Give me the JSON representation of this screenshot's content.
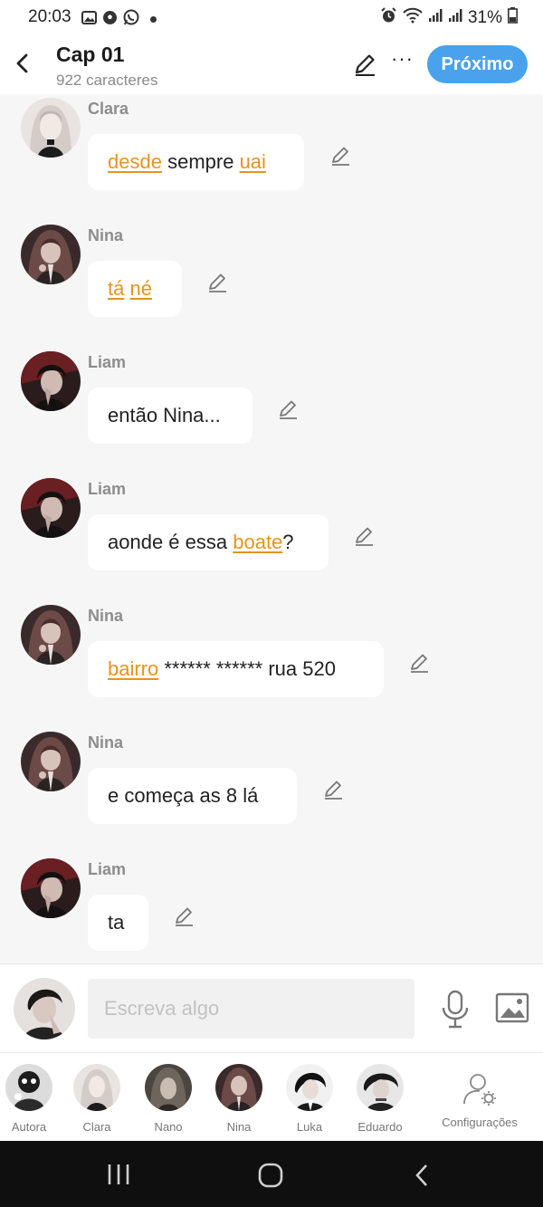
{
  "status_bar": {
    "time": "20:03",
    "battery": "31%",
    "left_icons": [
      "gallery-icon",
      "soccer-icon",
      "whatsapp-icon",
      "dot-icon"
    ],
    "right_icons": [
      "alarm-icon",
      "wifi-icon",
      "signal-icon",
      "signal-icon",
      "battery-icon"
    ]
  },
  "header": {
    "back_icon": "chevron-left-icon",
    "title": "Cap 01",
    "subtitle": "922 caracteres",
    "edit_icon": "pencil-icon",
    "more_label": "···",
    "next_label": "Próximo",
    "accent_color": "#4aa2ec"
  },
  "messages": [
    {
      "sender": "Clara",
      "parts": [
        {
          "t": "desdesempre",
          "u": false
        }
      ],
      "text": "desde sempre uai",
      "underlined": [
        "desde",
        "uai"
      ]
    },
    {
      "sender": "Nina",
      "text": "tá né",
      "underlined": [
        "tá",
        "né"
      ]
    },
    {
      "sender": "Liam",
      "text": "então Nina...",
      "underlined": []
    },
    {
      "sender": "Liam",
      "text": "aonde é essa boate?",
      "underlined": [
        "boate"
      ]
    },
    {
      "sender": "Nina",
      "text": "bairro ****** ****** rua 520",
      "underlined": [
        "bairro"
      ]
    },
    {
      "sender": "Nina",
      "text": "e começa as 8 lá",
      "underlined": []
    },
    {
      "sender": "Liam",
      "text": "ta",
      "underlined": []
    }
  ],
  "composer": {
    "placeholder": "Escreva algo",
    "mic_icon": "microphone-icon",
    "image_icon": "image-icon"
  },
  "characters": [
    {
      "name": "Autora"
    },
    {
      "name": "Clara"
    },
    {
      "name": "Nano"
    },
    {
      "name": "Nina"
    },
    {
      "name": "Luka"
    },
    {
      "name": "Eduardo"
    }
  ],
  "settings_label": "Configurações",
  "underline_color": "#e8931e"
}
